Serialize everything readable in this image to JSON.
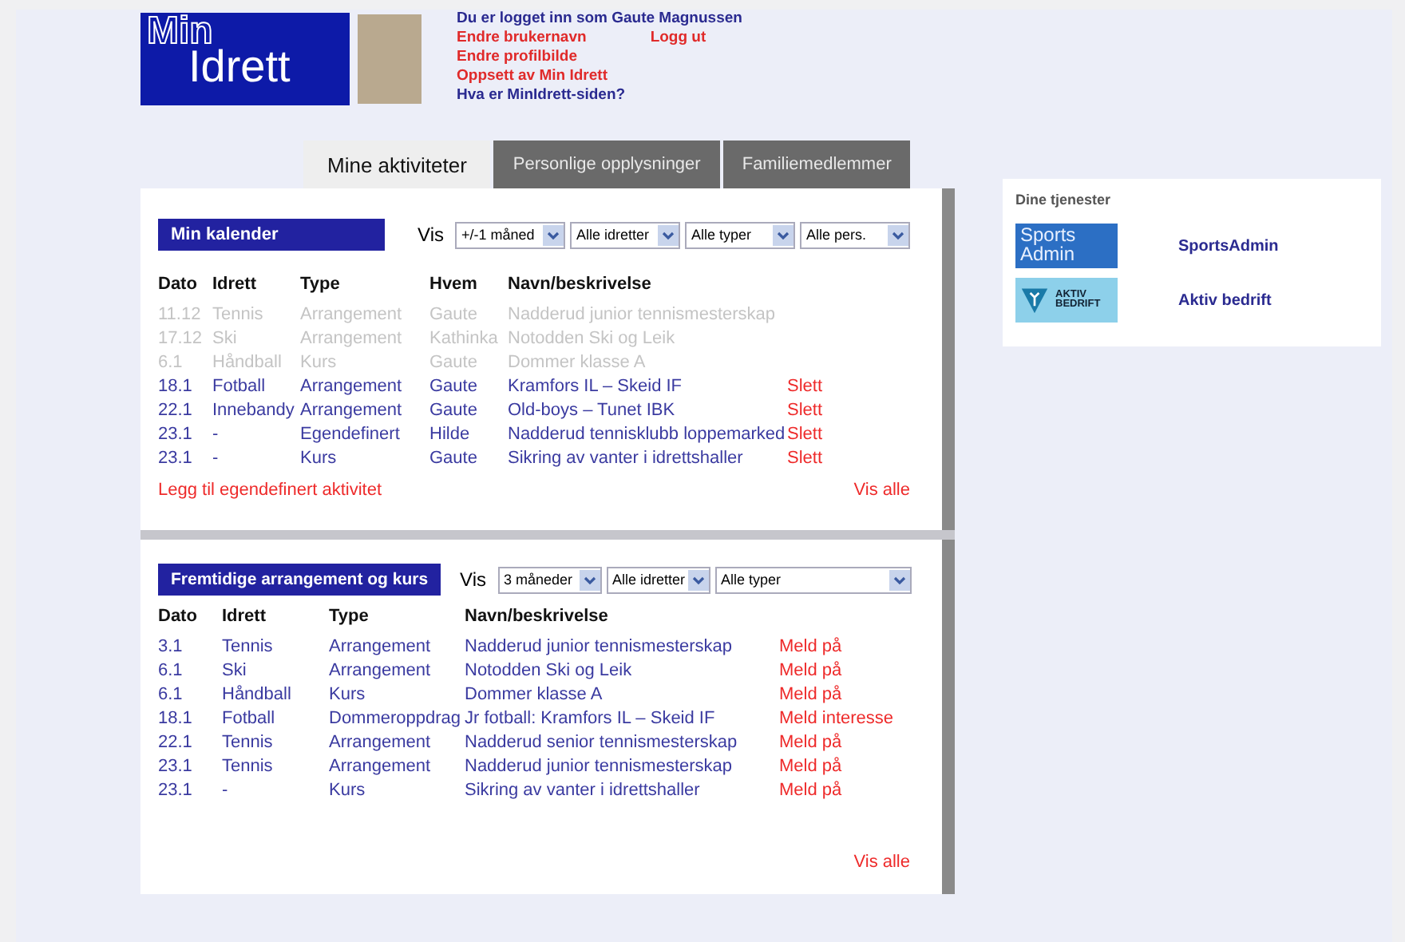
{
  "logo": {
    "line_1": "Min",
    "line_2": "Idrett"
  },
  "user": {
    "logged_in_text": "Du er logget inn som Gaute Magnussen",
    "logout": "Logg ut",
    "links": [
      {
        "label": "Endre brukernavn",
        "kind": "action"
      },
      {
        "label": "Endre profilbilde",
        "kind": "action"
      },
      {
        "label": "Oppsett av Min Idrett",
        "kind": "action"
      },
      {
        "label": "Hva er MinIdrett-siden?",
        "kind": "info"
      }
    ]
  },
  "tabs": [
    {
      "label": "Mine aktiviteter",
      "selected": true
    },
    {
      "label": "Personlige opplysninger",
      "selected": false
    },
    {
      "label": "Familiemedlemmer",
      "selected": false
    }
  ],
  "calendar": {
    "title": "Min kalender",
    "filter_label": "Vis",
    "filters": [
      "+/-1 måned",
      "Alle idretter",
      "Alle typer",
      "Alle pers."
    ],
    "columns": [
      "Dato",
      "Idrett",
      "Type",
      "Hvem",
      "Navn/beskrivelse"
    ],
    "rows": [
      {
        "date": "11.12",
        "sport": "Tennis",
        "type": "Arrangement",
        "who": "Gaute",
        "name": "Nadderud junior tennismesterskap",
        "past": true
      },
      {
        "date": "17.12",
        "sport": "Ski",
        "type": "Arrangement",
        "who": "Kathinka",
        "name": "Notodden Ski og Leik",
        "past": true
      },
      {
        "date": "6.1",
        "sport": "Håndball",
        "type": "Kurs",
        "who": "Gaute",
        "name": "Dommer klasse A",
        "past": true
      },
      {
        "date": "18.1",
        "sport": "Fotball",
        "type": "Arrangement",
        "who": "Gaute",
        "name": "Kramfors IL – Skeid IF",
        "past": false,
        "action": "Slett"
      },
      {
        "date": "22.1",
        "sport": "Innebandy",
        "type": "Arrangement",
        "who": "Gaute",
        "name": "Old-boys – Tunet IBK",
        "past": false,
        "action": "Slett"
      },
      {
        "date": "23.1",
        "sport": "-",
        "type": "Egendefinert",
        "who": "Hilde",
        "name": "Nadderud tennisklubb loppemarked",
        "past": false,
        "action": "Slett"
      },
      {
        "date": "23.1",
        "sport": "-",
        "type": "Kurs",
        "who": "Gaute",
        "name": "Sikring av vanter i idrettshaller",
        "past": false,
        "action": "Slett"
      }
    ],
    "add_link": "Legg til egendefinert aktivitet",
    "show_all": "Vis alle"
  },
  "upcoming": {
    "title": "Fremtidige arrangement og kurs",
    "filter_label": "Vis",
    "filters": [
      "3 måneder",
      "Alle idretter",
      "Alle typer"
    ],
    "columns": [
      "Dato",
      "Idrett",
      "Type",
      "Navn/beskrivelse"
    ],
    "rows": [
      {
        "date": "3.1",
        "sport": "Tennis",
        "type": "Arrangement",
        "name": "Nadderud junior tennismesterskap",
        "action": "Meld på"
      },
      {
        "date": "6.1",
        "sport": "Ski",
        "type": "Arrangement",
        "name": "Notodden Ski og Leik",
        "action": "Meld på"
      },
      {
        "date": "6.1",
        "sport": "Håndball",
        "type": "Kurs",
        "name": "Dommer klasse A",
        "action": "Meld på"
      },
      {
        "date": "18.1",
        "sport": "Fotball",
        "type": "Dommeroppdrag",
        "name": "Jr fotball: Kramfors IL – Skeid IF",
        "action": "Meld interesse"
      },
      {
        "date": "22.1",
        "sport": "Tennis",
        "type": "Arrangement",
        "name": "Nadderud senior tennismesterskap",
        "action": "Meld på"
      },
      {
        "date": "23.1",
        "sport": "Tennis",
        "type": "Arrangement",
        "name": "Nadderud junior tennismesterskap",
        "action": "Meld på"
      },
      {
        "date": "23.1",
        "sport": "-",
        "type": "Kurs",
        "name": "Sikring av vanter i idrettshaller",
        "action": "Meld på"
      }
    ],
    "show_all": "Vis alle"
  },
  "services": {
    "title": "Dine tjenester",
    "items": [
      {
        "kind": "sportsadmin",
        "logo_lines": [
          "Sports",
          "Admin"
        ],
        "label": "SportsAdmin"
      },
      {
        "kind": "aktiv",
        "logo_lines": [
          "AKTIV",
          "BEDRIFT"
        ],
        "label": "Aktiv bedrift"
      }
    ]
  }
}
